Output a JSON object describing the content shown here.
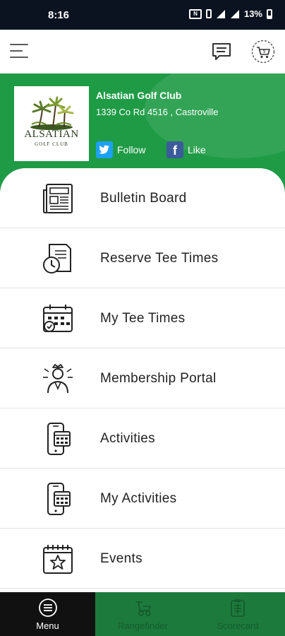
{
  "status_bar": {
    "time": "8:16",
    "battery": "13%",
    "nfc_label": "N"
  },
  "app_bar": {
    "menu_icon": "hamburger-icon",
    "chat_icon": "chat-icon",
    "cart_icon": "shopping-cart-icon"
  },
  "club": {
    "name": "Alsatian Golf Club",
    "address": "1339 Co Rd 4516 , Castroville",
    "logo_name": "ALSATIAN",
    "logo_sub": "GOLF CLUB",
    "follow_label": "Follow",
    "like_label": "Like",
    "colors": {
      "header_green": "#1f9b46",
      "twitter": "#1da1f2",
      "facebook": "#3b5b9a"
    }
  },
  "menu": {
    "items": [
      {
        "label": "Bulletin Board",
        "icon": "newspaper-icon"
      },
      {
        "label": "Reserve Tee Times",
        "icon": "document-clock-icon"
      },
      {
        "label": "My Tee Times",
        "icon": "calendar-icon"
      },
      {
        "label": "Membership Portal",
        "icon": "member-crown-icon"
      },
      {
        "label": "Activities",
        "icon": "phone-calendar-icon"
      },
      {
        "label": "My Activities",
        "icon": "phone-calendar-icon"
      },
      {
        "label": "Events",
        "icon": "event-calendar-star-icon"
      }
    ]
  },
  "bottom_nav": {
    "tabs": [
      {
        "label": "Menu",
        "icon": "menu-circle-icon",
        "active": true
      },
      {
        "label": "Rangefinder",
        "icon": "golf-cart-icon",
        "active": false
      },
      {
        "label": "Scorecard",
        "icon": "scorecard-icon",
        "active": false
      }
    ],
    "colors": {
      "active_bg": "#111111",
      "inactive_bg": "#1c7a3c"
    }
  }
}
